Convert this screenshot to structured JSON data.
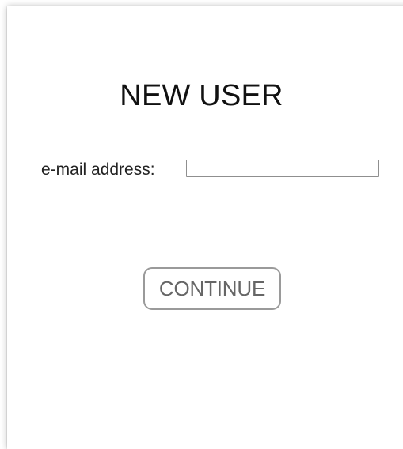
{
  "form": {
    "title": "NEW USER",
    "email_label": "e-mail address:",
    "email_value": "",
    "continue_label": "CONTINUE"
  }
}
